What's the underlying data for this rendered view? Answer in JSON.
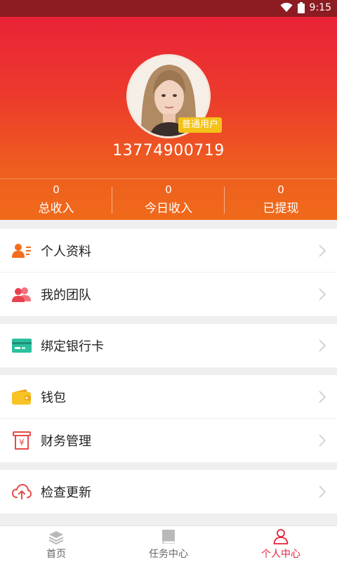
{
  "status_bar": {
    "time": "9:15",
    "icons": [
      "wifi-icon",
      "battery-icon"
    ]
  },
  "profile": {
    "badge": "普通用户",
    "phone": "13774900719"
  },
  "stats": [
    {
      "value": "0",
      "label": "总收入"
    },
    {
      "value": "0",
      "label": "今日收入"
    },
    {
      "value": "0",
      "label": "已提现"
    }
  ],
  "menu": {
    "personal_info": "个人资料",
    "my_team": "我的团队",
    "bind_bank_card": "绑定银行卡",
    "wallet": "钱包",
    "finance": "财务管理",
    "check_update": "检查更新"
  },
  "tabs": [
    {
      "label": "首页",
      "icon": "layers-icon",
      "active": false
    },
    {
      "label": "任务中心",
      "icon": "book-icon",
      "active": false
    },
    {
      "label": "个人中心",
      "icon": "person-icon",
      "active": true
    }
  ],
  "colors": {
    "primary": "#e8203a",
    "gradient_top": "#ea2337",
    "gradient_bottom": "#f06a1a",
    "badge": "#f5c21a",
    "status_bar": "#8d1b22"
  }
}
